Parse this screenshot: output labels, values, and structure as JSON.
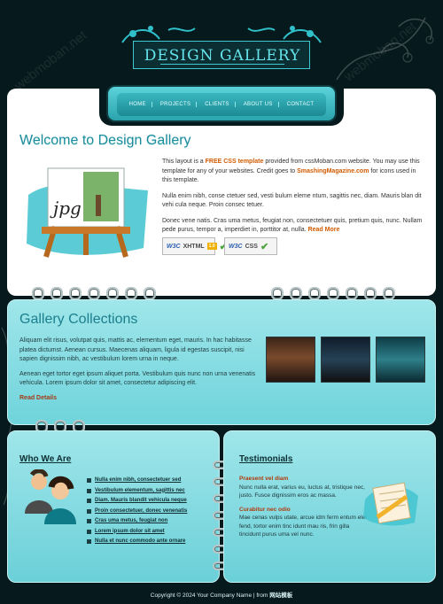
{
  "site": {
    "logo_text": "DESIGN GALLERY",
    "accent": "#3ec8d1",
    "watermark_text": "webmoban.net"
  },
  "nav": {
    "items": [
      {
        "label": "HOME"
      },
      {
        "label": "PROJECTS"
      },
      {
        "label": "CLIENTS"
      },
      {
        "label": "ABOUT US"
      },
      {
        "label": "CONTACT"
      }
    ]
  },
  "welcome": {
    "title": "Welcome to Design Gallery",
    "image_label": "jpg",
    "p1_a": "This layout is a ",
    "p1_hl": "FREE CSS template",
    "p1_b": " provided from cssMoban.com website. You may use this template for any of your websites. Credit goes to ",
    "p1_hl2": "SmashingMagazine.com",
    "p1_c": " for icons used in this template.",
    "p2": "Nulla enim nibh, conse ctetuer sed, vesti bulum eleme ntum, sagittis nec, diam. Mauris blan dit vehi cula neque. Proin consec tetuer.",
    "p3_a": "Donec vene natis. Cras uma metus, feugiat non, consectetuer quis, pretium quis, nunc. Nullam pede purus, tempor a, imperdiet in, porttitor at, nulla. ",
    "p3_link": "Read More",
    "badge_xhtml": "XHTML",
    "badge_xhtml_ver": "1.0",
    "badge_css": "CSS",
    "badge_w3c": "W3C"
  },
  "gallery": {
    "title": "Gallery Collections",
    "p1": "Aliquam elit risus, volutpat quis, mattis ac, elementum eget, mauris. In hac habitasse platea dictumst. Aenean cursus. Maecenas aliquam, ligula id egestas suscipit, nisi sapien dignissim nibh, ac vestibulum lorem urna in neque.",
    "p2": "Aenean eget tortor eget ipsum aliquet porta. Vestibulum quis nunc non urna venenatis vehicula. Lorem ipsum dolor sit amet, consectetur adipiscing elit.",
    "read_details": "Read Details"
  },
  "who": {
    "title": "Who We Are",
    "items": [
      "Nulla enim nibh, consectetuer sed",
      "Vestibulum elementum, sagittis nec",
      "Diam. Mauris blandit vehicula neque",
      "Proin consectetuer, donec venenatis",
      "Cras uma metus, feugiat non",
      "Lorem ipsum dolor sit amet",
      "Nulla et nunc commodo ante ornare"
    ]
  },
  "testimonials": {
    "title": "Testimonials",
    "t1_name": "Praesent vel diam",
    "t1_text": "Nunc nulla erat, varius eu, luctus at, tristique nec, justo. Fusce dignissim eros ac massa.",
    "t2_name": "Curabitur nec odio",
    "t2_text": "Mae cenas vulps utate, arcue idm ferm entum elei fend, tortor enim tinc idunt mau ris, frin gilla tincidunt purus uma vel nunc."
  },
  "footer": {
    "text": "Copyright © 2024 Your Company Name | from ",
    "brand": "网站模板"
  }
}
